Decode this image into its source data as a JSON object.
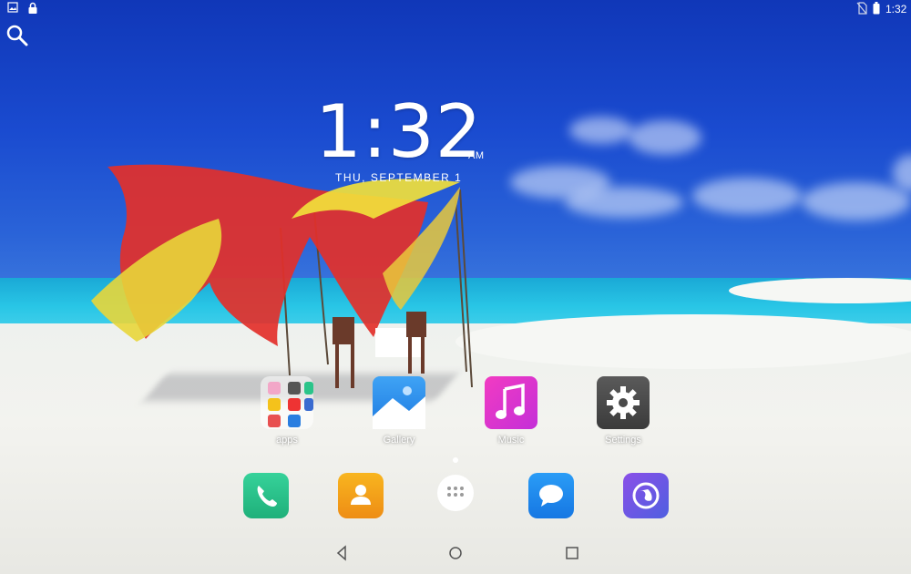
{
  "status_bar": {
    "time": "1:32",
    "left_icons": [
      "image-icon",
      "lock-icon"
    ],
    "right_icons": [
      "no-sim-icon",
      "battery-icon"
    ]
  },
  "clock": {
    "time": "1:32",
    "ampm": "AM",
    "date": "THU, SEPTEMBER 1"
  },
  "home_apps": [
    {
      "label": "apps",
      "icon": "folder-icon"
    },
    {
      "label": "Gallery",
      "icon": "gallery-icon",
      "color": "#2b8ef0"
    },
    {
      "label": "Music",
      "icon": "music-icon",
      "color": "#e23ad0"
    },
    {
      "label": "Settings",
      "icon": "settings-icon",
      "color": "#4a4a4a"
    }
  ],
  "dock": [
    {
      "icon": "phone-icon",
      "color": "#2bc48a"
    },
    {
      "icon": "contacts-icon",
      "color": "#f3a21b"
    },
    {
      "icon": "all-apps-icon",
      "color": "#ffffff"
    },
    {
      "icon": "messaging-icon",
      "color": "#1e8af0"
    },
    {
      "icon": "browser-icon",
      "color": "#6a52e0"
    }
  ],
  "nav_bar": [
    "back-icon",
    "home-icon",
    "recents-icon"
  ]
}
